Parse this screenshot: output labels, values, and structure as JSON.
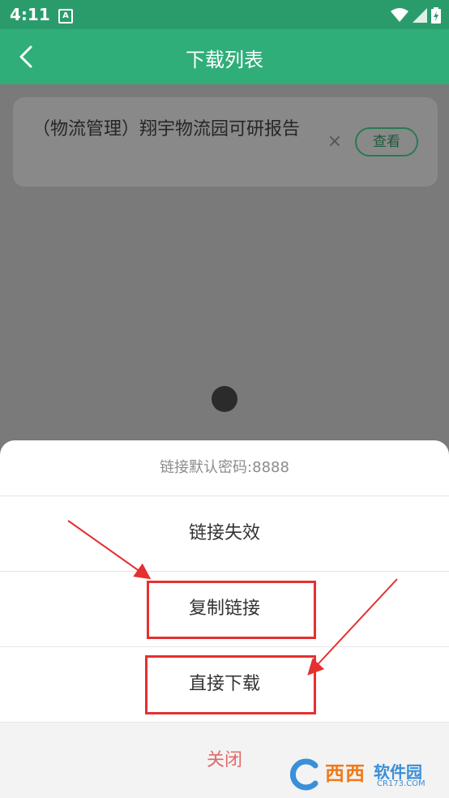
{
  "status_bar": {
    "time": "4:11",
    "badge_letter": "A",
    "icons": [
      "wifi-icon",
      "signal-icon",
      "battery-icon"
    ]
  },
  "toolbar": {
    "title": "下载列表",
    "back_icon": "chevron-left-icon"
  },
  "download_list": {
    "items": [
      {
        "title": "（物流管理）翔宇物流园可研报告",
        "close_label": "×",
        "view_label": "查看"
      }
    ]
  },
  "sheet": {
    "header": "链接默认密码:8888",
    "items": [
      "链接失效",
      "复制链接",
      "直接下载"
    ],
    "close_label": "关闭"
  },
  "colors": {
    "status_bar": "#2a9c6c",
    "toolbar": "#2fae7a",
    "overlay": "#7a7a7a",
    "close_text": "#e06a6a",
    "annotation": "#e53030"
  },
  "watermark": {
    "brand_cn": "西西",
    "brand_sub": "软件园",
    "domain": "CR173.COM"
  }
}
